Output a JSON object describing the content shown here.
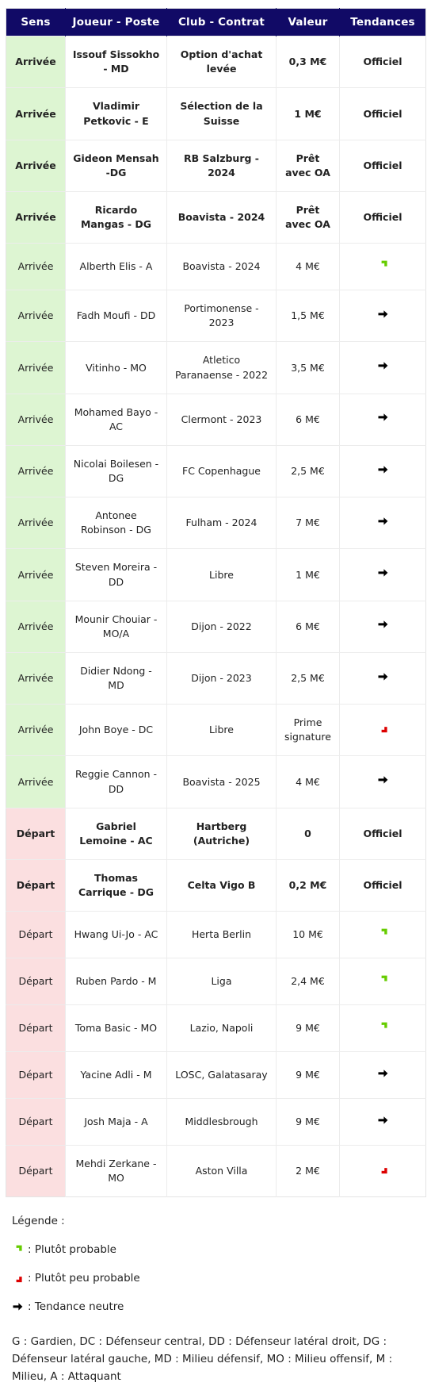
{
  "table": {
    "columns": [
      "Sens",
      "Joueur - Poste",
      "Club - Contrat",
      "Valeur",
      "Tendances"
    ],
    "colors": {
      "header_bg": "#110a66",
      "header_text": "#ffffff",
      "arrivee_bg": "#ddf5d2",
      "depart_bg": "#fbdfe0",
      "trend_up": "#66cc00",
      "trend_down": "#dd0000",
      "trend_neutral": "#000000",
      "grid": "#ececec"
    },
    "rows": [
      {
        "sens": "Arrivée",
        "joueur": "Issouf Sissokho - MD",
        "club": "Option d'achat levée",
        "valeur": "0,3 M€",
        "tendance": "Officiel",
        "trend_icon": "none",
        "official": true,
        "type": "arrivee"
      },
      {
        "sens": "Arrivée",
        "joueur": "Vladimir Petkovic - E",
        "club": "Sélection de la Suisse",
        "valeur": "1 M€",
        "tendance": "Officiel",
        "trend_icon": "none",
        "official": true,
        "type": "arrivee"
      },
      {
        "sens": "Arrivée",
        "joueur": "Gideon Mensah -DG",
        "club": "RB Salzburg - 2024",
        "valeur": "Prêt avec OA",
        "tendance": "Officiel",
        "trend_icon": "none",
        "official": true,
        "type": "arrivee"
      },
      {
        "sens": "Arrivée",
        "joueur": "Ricardo Mangas - DG",
        "club": "Boavista - 2024",
        "valeur": "Prêt avec OA",
        "tendance": "Officiel",
        "trend_icon": "none",
        "official": true,
        "type": "arrivee"
      },
      {
        "sens": "Arrivée",
        "joueur": "Alberth Elis - A",
        "club": "Boavista - 2024",
        "valeur": "4 M€",
        "tendance": "",
        "trend_icon": "up",
        "official": false,
        "type": "arrivee"
      },
      {
        "sens": "Arrivée",
        "joueur": "Fadh Moufi - DD",
        "club": "Portimonense - 2023",
        "valeur": "1,5 M€",
        "tendance": "",
        "trend_icon": "neutral",
        "official": false,
        "type": "arrivee"
      },
      {
        "sens": "Arrivée",
        "joueur": "Vitinho - MO",
        "club": "Atletico Paranaense - 2022",
        "valeur": "3,5 M€",
        "tendance": "",
        "trend_icon": "neutral",
        "official": false,
        "type": "arrivee"
      },
      {
        "sens": "Arrivée",
        "joueur": "Mohamed Bayo - AC",
        "club": "Clermont - 2023",
        "valeur": "6 M€",
        "tendance": "",
        "trend_icon": "neutral",
        "official": false,
        "type": "arrivee"
      },
      {
        "sens": "Arrivée",
        "joueur": "Nicolai Boilesen - DG",
        "club": "FC Copenhague",
        "valeur": "2,5 M€",
        "tendance": "",
        "trend_icon": "neutral",
        "official": false,
        "type": "arrivee"
      },
      {
        "sens": "Arrivée",
        "joueur": "Antonee Robinson - DG",
        "club": "Fulham - 2024",
        "valeur": "7 M€",
        "tendance": "",
        "trend_icon": "neutral",
        "official": false,
        "type": "arrivee"
      },
      {
        "sens": "Arrivée",
        "joueur": "Steven Moreira - DD",
        "club": "Libre",
        "valeur": "1 M€",
        "tendance": "",
        "trend_icon": "neutral",
        "official": false,
        "type": "arrivee"
      },
      {
        "sens": "Arrivée",
        "joueur": "Mounir Chouiar - MO/A",
        "club": "Dijon - 2022",
        "valeur": "6 M€",
        "tendance": "",
        "trend_icon": "neutral",
        "official": false,
        "type": "arrivee"
      },
      {
        "sens": "Arrivée",
        "joueur": "Didier Ndong - MD",
        "club": "Dijon - 2023",
        "valeur": "2,5 M€",
        "tendance": "",
        "trend_icon": "neutral",
        "official": false,
        "type": "arrivee"
      },
      {
        "sens": "Arrivée",
        "joueur": "John Boye - DC",
        "club": "Libre",
        "valeur": "Prime signature",
        "tendance": "",
        "trend_icon": "down",
        "official": false,
        "type": "arrivee"
      },
      {
        "sens": "Arrivée",
        "joueur": "Reggie Cannon - DD",
        "club": "Boavista - 2025",
        "valeur": "4 M€",
        "tendance": "",
        "trend_icon": "neutral",
        "official": false,
        "type": "arrivee"
      },
      {
        "sens": "Départ",
        "joueur": "Gabriel Lemoine - AC",
        "club": "Hartberg (Autriche)",
        "valeur": "0",
        "tendance": "Officiel",
        "trend_icon": "none",
        "official": true,
        "type": "depart"
      },
      {
        "sens": "Départ",
        "joueur": "Thomas Carrique - DG",
        "club": "Celta Vigo B",
        "valeur": "0,2 M€",
        "tendance": "Officiel",
        "trend_icon": "none",
        "official": true,
        "type": "depart"
      },
      {
        "sens": "Départ",
        "joueur": "Hwang Ui-Jo - AC",
        "club": "Herta Berlin",
        "valeur": "10 M€",
        "tendance": "",
        "trend_icon": "up",
        "official": false,
        "type": "depart"
      },
      {
        "sens": "Départ",
        "joueur": "Ruben Pardo - M",
        "club": "Liga",
        "valeur": "2,4 M€",
        "tendance": "",
        "trend_icon": "up",
        "official": false,
        "type": "depart"
      },
      {
        "sens": "Départ",
        "joueur": "Toma Basic - MO",
        "club": "Lazio, Napoli",
        "valeur": "9 M€",
        "tendance": "",
        "trend_icon": "up",
        "official": false,
        "type": "depart"
      },
      {
        "sens": "Départ",
        "joueur": "Yacine Adli - M",
        "club": "LOSC, Galatasaray",
        "valeur": "9 M€",
        "tendance": "",
        "trend_icon": "neutral",
        "official": false,
        "type": "depart"
      },
      {
        "sens": "Départ",
        "joueur": "Josh Maja - A",
        "club": "Middlesbrough",
        "valeur": "9 M€",
        "tendance": "",
        "trend_icon": "neutral",
        "official": false,
        "type": "depart"
      },
      {
        "sens": "Départ",
        "joueur": "Mehdi Zerkane - MO",
        "club": "Aston Villa",
        "valeur": "2 M€",
        "tendance": "",
        "trend_icon": "down",
        "official": false,
        "type": "depart"
      }
    ]
  },
  "legend": {
    "title": "Légende :",
    "items": [
      {
        "icon": "up",
        "text": ": Plutôt probable"
      },
      {
        "icon": "down",
        "text": ": Plutôt peu probable"
      },
      {
        "icon": "neutral",
        "text": ": Tendance neutre"
      }
    ],
    "abbreviations": "G : Gardien, DC : Défenseur central, DD : Défenseur latéral droit, DG : Défenseur latéral gauche, MD : Milieu défensif, MO : Milieu offensif, M : Milieu, A : Attaquant"
  }
}
